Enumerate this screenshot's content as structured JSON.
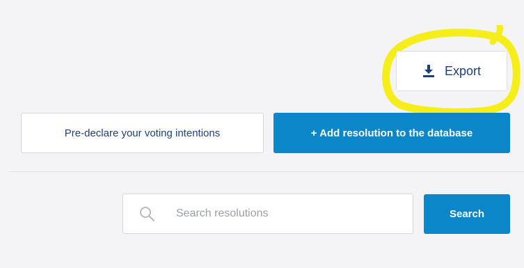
{
  "toolbar": {
    "export_label": "Export"
  },
  "actions": {
    "predeclare_label": "Pre-declare your voting intentions",
    "add_resolution_label": "+ Add resolution to the database"
  },
  "search": {
    "placeholder": "Search resolutions",
    "value": "",
    "button_label": "Search"
  },
  "icons": {
    "export": "download-icon",
    "search": "search-icon"
  },
  "colors": {
    "primary": "#0b86c8",
    "text_dark": "#1e3f7a",
    "highlight": "#f5ee1a",
    "background": "#f4f4f6"
  }
}
